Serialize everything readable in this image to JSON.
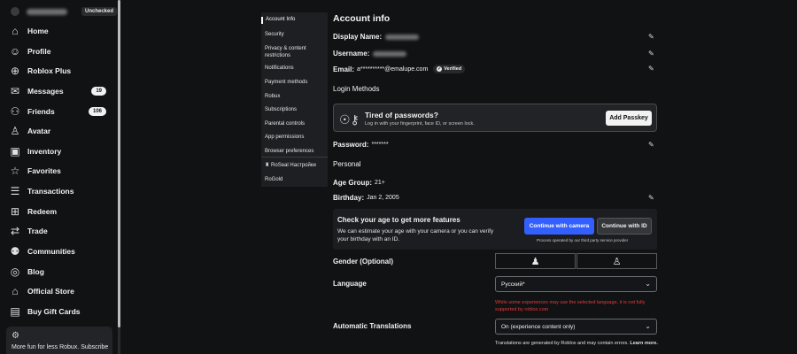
{
  "user": {
    "status_badge": "Unchecked"
  },
  "nav": {
    "items": [
      {
        "label": "Home",
        "icon": "home-icon"
      },
      {
        "label": "Profile",
        "icon": "profile-icon"
      },
      {
        "label": "Roblox Plus",
        "icon": "plus-icon"
      },
      {
        "label": "Messages",
        "icon": "messages-icon",
        "badge": "19"
      },
      {
        "label": "Friends",
        "icon": "friends-icon",
        "badge": "106"
      },
      {
        "label": "Avatar",
        "icon": "avatar-icon"
      },
      {
        "label": "Inventory",
        "icon": "inventory-icon"
      },
      {
        "label": "Favorites",
        "icon": "favorites-icon"
      },
      {
        "label": "Transactions",
        "icon": "transactions-icon"
      },
      {
        "label": "Redeem",
        "icon": "gift-icon"
      },
      {
        "label": "Trade",
        "icon": "trade-icon"
      },
      {
        "label": "Communities",
        "icon": "communities-icon"
      },
      {
        "label": "Blog",
        "icon": "blog-icon"
      },
      {
        "label": "Official Store",
        "icon": "store-icon"
      },
      {
        "label": "Buy Gift Cards",
        "icon": "giftcard-icon"
      }
    ],
    "promo_text": "More fun for less Robux. Subscribe"
  },
  "settings_menu": {
    "items": [
      "Account Info",
      "Security",
      "Privacy & content restrictions",
      "Notifications",
      "Payment methods",
      "Robux",
      "Subscriptions",
      "Parental controls",
      "App permissions",
      "Browser preferences",
      "RoSeal Настройки",
      "RoGold"
    ]
  },
  "account": {
    "heading": "Account info",
    "display_name_label": "Display Name:",
    "username_label": "Username:",
    "email_label": "Email:",
    "email_value": "a**********@emalupe.com",
    "verified_label": "Verified",
    "login_methods_heading": "Login Methods",
    "passkey_title": "Tired of passwords?",
    "passkey_desc": "Log in with your fingerprint, face ID, or screen lock.",
    "add_passkey_label": "Add Passkey",
    "password_label": "Password:",
    "password_value": "*******",
    "personal_heading": "Personal",
    "age_group_label": "Age Group:",
    "age_group_value": "21+",
    "birthday_label": "Birthday:",
    "birthday_value": "Jan 2, 2005",
    "age_check_title": "Check your age to get more features",
    "age_check_desc": "We can estimate your age with your camera or you can verify your birthday with an ID.",
    "camera_btn": "Continue with camera",
    "id_btn": "Continue with ID",
    "provider_note": "Process operated by our third party service provider",
    "gender_label": "Gender (Optional)",
    "language_label": "Language",
    "language_value": "Русский*",
    "language_warning": "While some experiences may use the selected language, it is not fully supported by roblox.com",
    "auto_translations_label": "Automatic Translations",
    "auto_translations_value": "On (experience content only)",
    "translations_note": "Translations are generated by Roblox and may contain errors.",
    "learn_more": "Learn more."
  }
}
